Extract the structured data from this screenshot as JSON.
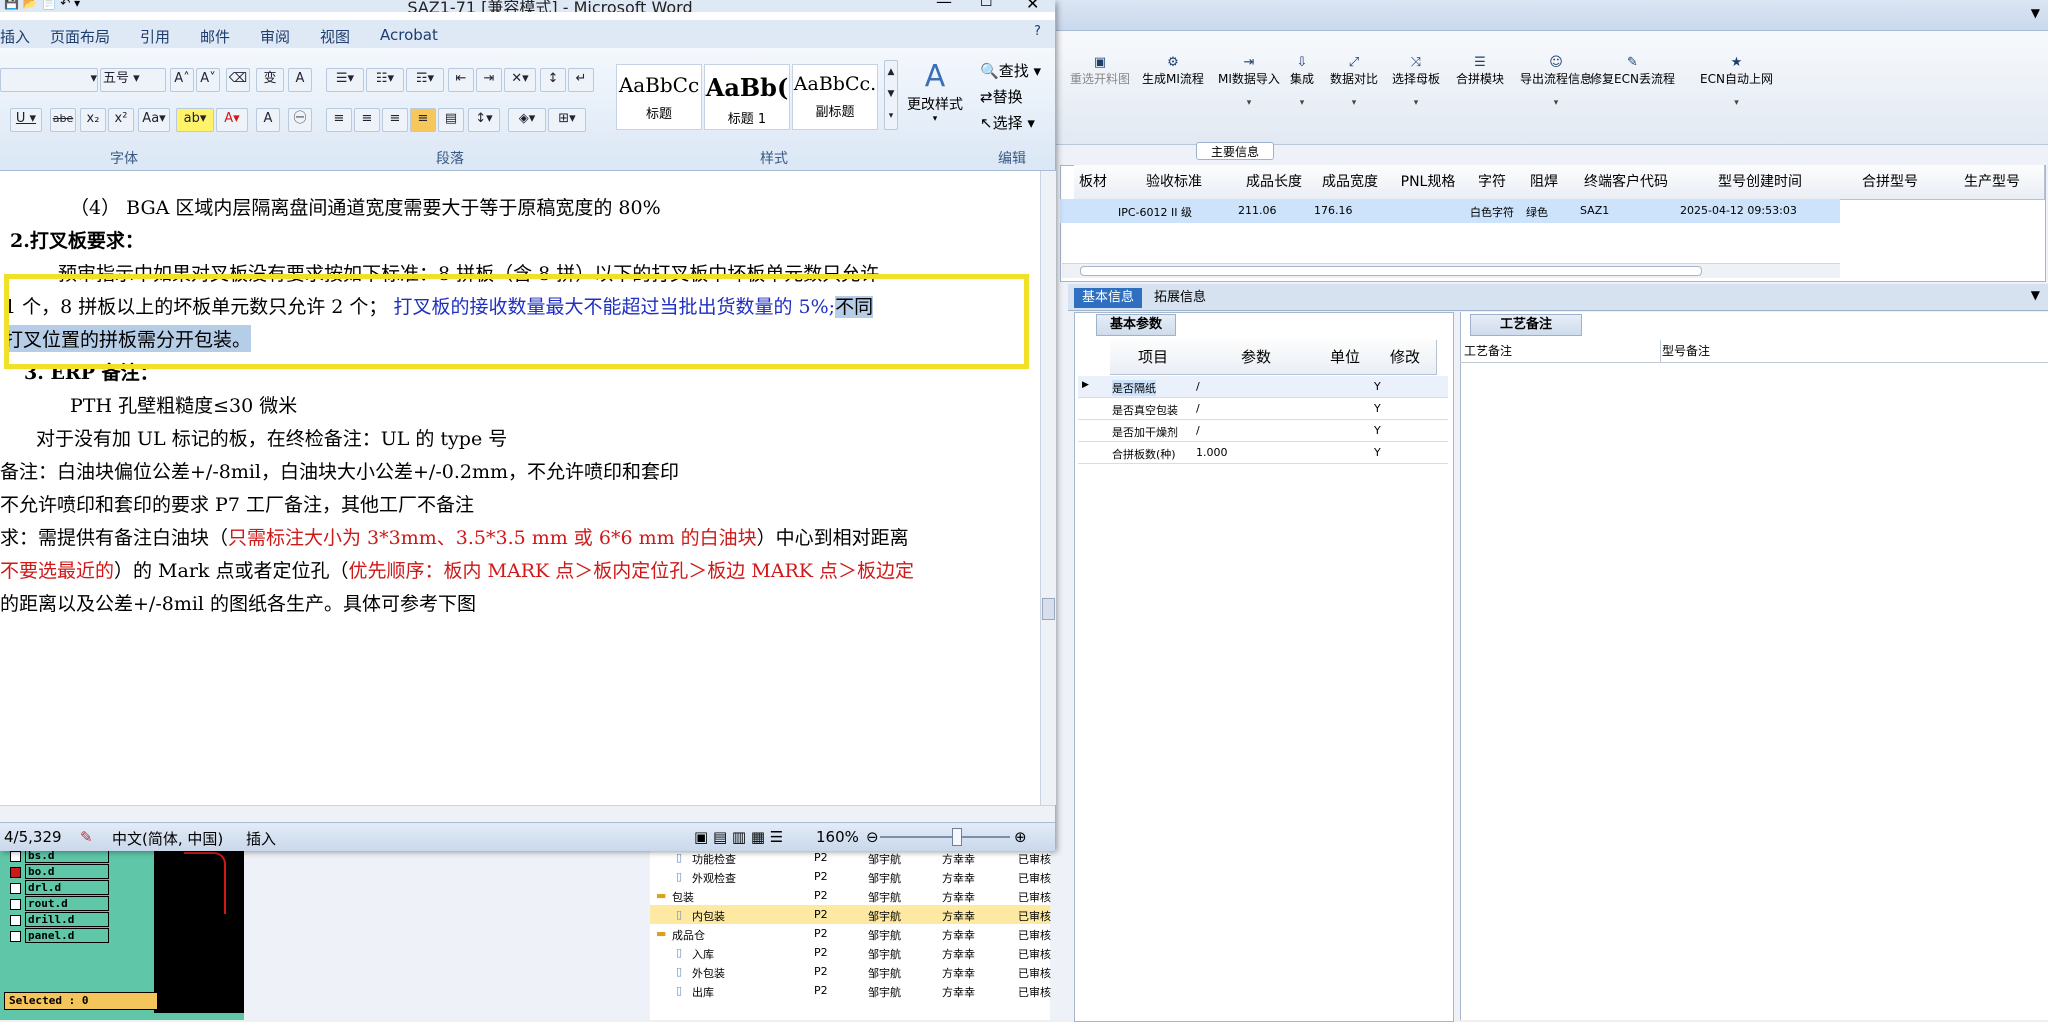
{
  "word": {
    "title": "SAZ1-71 [兼容模式] - Microsoft Word",
    "tabs": [
      "插入",
      "页面布局",
      "引用",
      "邮件",
      "审阅",
      "视图",
      "Acrobat"
    ],
    "font_size": "五号",
    "styles": [
      {
        "preview": "AaBbCc",
        "name": "标题"
      },
      {
        "preview": "AaBb(",
        "name": "标题 1"
      },
      {
        "preview": "AaBbCc.",
        "name": "副标题"
      }
    ],
    "change_styles": "更改样式",
    "edit": {
      "find": "查找",
      "replace": "替换",
      "select": "选择"
    },
    "groups": {
      "font": "字体",
      "paragraph": "段落",
      "style": "样式",
      "edit": "编辑"
    }
  },
  "doc": {
    "l1": "（4） BGA 区域内层隔离盘间通道宽度需要大于等于原稿宽度的 80%",
    "l2": "2.打叉板要求：",
    "l3": "预审指示中如果对叉板没有要求按如下标准：8 拼板（含 8 拼）以下的打叉板中坏板单元数只允许",
    "l4a": "1 个，8 拼板以上的坏板单元数只允许 2 个；",
    "l4b": "打叉板的接收数量最大不能超过当批出货数量的 5%;",
    "l4c": "不同",
    "l5": "打叉位置的拼板需分开包装。",
    "l6": "3. ERP 备注：",
    "l7": "PTH 孔壁粗糙度≤30 微米",
    "l8": "对于没有加 UL 标记的板，在终检备注：UL 的 type 号",
    "l9": "备注：白油块偏位公差+/-8mil，白油块大小公差+/-0.2mm，不允许喷印和套印",
    "l10": "不允许喷印和套印的要求 P7 工厂备注，其他工厂不备注",
    "l11a": "求：需提供有备注白油块（",
    "l11b": "只需标注大小为 3*3mm、3.5*3.5 mm 或 6*6 mm 的白油块",
    "l11c": "）中心到相对距离",
    "l12a": "不要选最近的",
    "l12b": "）的 Mark 点或者定位孔（",
    "l12c": "优先顺序：板内 MARK 点＞板内定位孔＞板边 MARK 点＞板边定",
    "l13": "的距离以及公差+/-8mil 的图纸各生产。具体可参考下图"
  },
  "status": {
    "pages": "4/5,329",
    "lang": "中文(简体, 中国)",
    "mode": "插入",
    "zoom": "160%"
  },
  "app": {
    "toolbar": [
      {
        "label": "重选开料图",
        "icon": "▣"
      },
      {
        "label": "生成MI流程",
        "icon": "⚙"
      },
      {
        "label": "MI数据导入",
        "icon": "⇥"
      },
      {
        "label": "集成",
        "icon": "⇩"
      },
      {
        "label": "数据对比",
        "icon": "⤢"
      },
      {
        "label": "选择母板",
        "icon": "⤨"
      },
      {
        "label": "合拼模块",
        "icon": "☰"
      },
      {
        "label": "导出流程信息",
        "icon": "☺"
      },
      {
        "label": "修复ECN丢流程",
        "icon": "✎"
      },
      {
        "label": "ECN自动上网",
        "icon": "★"
      }
    ],
    "group_label": "主要信息",
    "grid_headers": [
      "板材",
      "验收标准",
      "成品长度",
      "成品宽度",
      "PNL规格",
      "字符",
      "阻焊",
      "终端客户代码",
      "型号创建时间",
      "合拼型号",
      "生产型号"
    ],
    "grid_row": [
      "",
      "IPC-6012 II 级",
      "211.06",
      "176.16",
      "",
      "白色字符",
      "绿色",
      "SAZ1",
      "2025-04-12 09:53:03"
    ],
    "lower_tabs": [
      "基本信息",
      "拓展信息"
    ],
    "basic_title": "基本参数",
    "basic_headers": [
      "项目",
      "参数",
      "单位",
      "修改"
    ],
    "basic_rows": [
      [
        "是否隔纸",
        "/",
        "",
        "Y"
      ],
      [
        "是否真空包装",
        "/",
        "",
        "Y"
      ],
      [
        "是否加干燥剂",
        "/",
        "",
        "Y"
      ],
      [
        "合拼板数(种)",
        "1.000",
        "",
        "Y"
      ]
    ],
    "craft_title": "工艺备注",
    "craft_cols": [
      "工艺备注",
      "型号备注"
    ]
  },
  "cam": {
    "layers": [
      "bs.d",
      "bo.d",
      "drl.d",
      "rout.d",
      "drill.d",
      "panel.d"
    ],
    "selected": "Selected : 0"
  },
  "tree": [
    {
      "name": "功能检查",
      "c2": "P2",
      "c3": "邹宇航",
      "c4": "方幸幸",
      "c5": "已审核",
      "indent": 2
    },
    {
      "name": "外观检查",
      "c2": "P2",
      "c3": "邹宇航",
      "c4": "方幸幸",
      "c5": "已审核",
      "indent": 2
    },
    {
      "name": "包装",
      "c2": "P2",
      "c3": "邹宇航",
      "c4": "方幸幸",
      "c5": "已审核",
      "indent": 1
    },
    {
      "name": "内包装",
      "c2": "P2",
      "c3": "邹宇航",
      "c4": "方幸幸",
      "c5": "已审核",
      "indent": 2,
      "sel": true
    },
    {
      "name": "成品仓",
      "c2": "P2",
      "c3": "邹宇航",
      "c4": "方幸幸",
      "c5": "已审核",
      "indent": 1
    },
    {
      "name": "入库",
      "c2": "P2",
      "c3": "邹宇航",
      "c4": "方幸幸",
      "c5": "已审核",
      "indent": 2
    },
    {
      "name": "外包装",
      "c2": "P2",
      "c3": "邹宇航",
      "c4": "方幸幸",
      "c5": "已审核",
      "indent": 2
    },
    {
      "name": "出库",
      "c2": "P2",
      "c3": "邹宇航",
      "c4": "方幸幸",
      "c5": "已审核",
      "indent": 2
    }
  ]
}
